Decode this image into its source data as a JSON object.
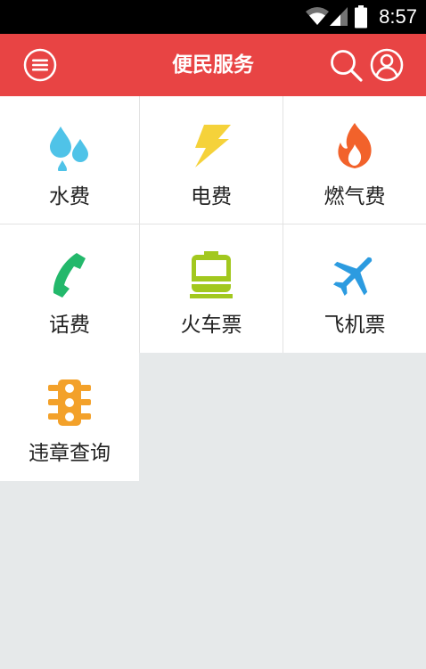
{
  "status_bar": {
    "time": "8:57",
    "icons": [
      "wifi-icon",
      "signal-icon",
      "battery-icon"
    ]
  },
  "app_bar": {
    "title": "便民服务",
    "icons": [
      "menu-icon",
      "search-icon",
      "user-icon"
    ]
  },
  "services": [
    {
      "label": "水费",
      "icon": "water-drops-icon",
      "color": "#4fc3e8"
    },
    {
      "label": "电费",
      "icon": "lightning-icon",
      "color": "#f5d23a"
    },
    {
      "label": "燃气费",
      "icon": "flame-icon",
      "color": "#f2622b"
    },
    {
      "label": "话费",
      "icon": "phone-icon",
      "color": "#23b86b"
    },
    {
      "label": "火车票",
      "icon": "train-icon",
      "color": "#a2c81e"
    },
    {
      "label": "飞机票",
      "icon": "airplane-icon",
      "color": "#2c9be0"
    },
    {
      "label": "违章查询",
      "icon": "traffic-light-icon",
      "color": "#f3a12a"
    }
  ],
  "colors": {
    "app_bar": "#e84444",
    "background": "#e6e9ea",
    "tile": "#ffffff"
  }
}
